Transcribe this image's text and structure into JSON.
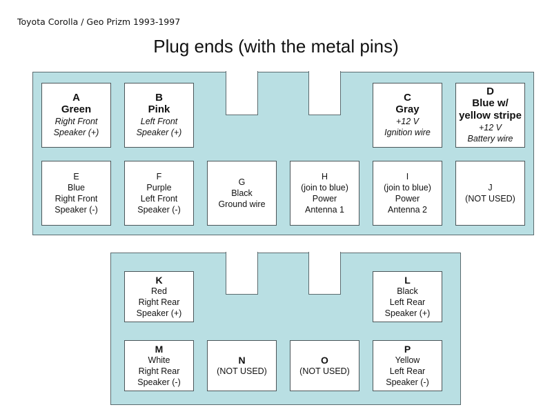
{
  "header": {
    "subtitle": "Toyota Corolla / Geo Prizm 1993-1997",
    "title": "Plug ends (with the metal pins)"
  },
  "colors": {
    "plug_fill": "#b9dfe3",
    "border": "#5a6a6e",
    "pin_fill": "#ffffff"
  },
  "plug1": {
    "pins": {
      "A": {
        "letter": "A",
        "lines": [
          "Green",
          "Right Front",
          "Speaker (+)"
        ]
      },
      "B": {
        "letter": "B",
        "lines": [
          "Pink",
          "Left Front",
          "Speaker (+)"
        ]
      },
      "C": {
        "letter": "C",
        "lines": [
          "Gray",
          "+12 V",
          "Ignition wire"
        ]
      },
      "D": {
        "letter": "D",
        "lines": [
          "Blue w/",
          "yellow stripe",
          "+12 V",
          "Battery wire"
        ]
      },
      "E": {
        "letter": "E",
        "lines": [
          "Blue",
          "Right Front",
          "Speaker (-)"
        ]
      },
      "F": {
        "letter": "F",
        "lines": [
          "Purple",
          "Left Front",
          "Speaker (-)"
        ]
      },
      "G": {
        "letter": "G",
        "lines": [
          "Black",
          "Ground wire"
        ]
      },
      "H": {
        "letter": "H",
        "lines": [
          "(join to blue)",
          "Power",
          "Antenna 1"
        ]
      },
      "I": {
        "letter": "I",
        "lines": [
          "(join to blue)",
          "Power",
          "Antenna 2"
        ]
      },
      "J": {
        "letter": "J",
        "lines": [
          "(NOT USED)"
        ]
      }
    }
  },
  "plug2": {
    "pins": {
      "K": {
        "letter": "K",
        "lines": [
          "Red",
          "Right Rear",
          "Speaker (+)"
        ]
      },
      "L": {
        "letter": "L",
        "lines": [
          "Black",
          "Left Rear",
          "Speaker (+)"
        ]
      },
      "M": {
        "letter": "M",
        "lines": [
          "White",
          "Right Rear",
          "Speaker (-)"
        ]
      },
      "N": {
        "letter": "N",
        "lines": [
          "(NOT USED)"
        ]
      },
      "O": {
        "letter": "O",
        "lines": [
          "(NOT USED)"
        ]
      },
      "P": {
        "letter": "P",
        "lines": [
          "Yellow",
          "Left Rear",
          "Speaker (-)"
        ]
      }
    }
  }
}
